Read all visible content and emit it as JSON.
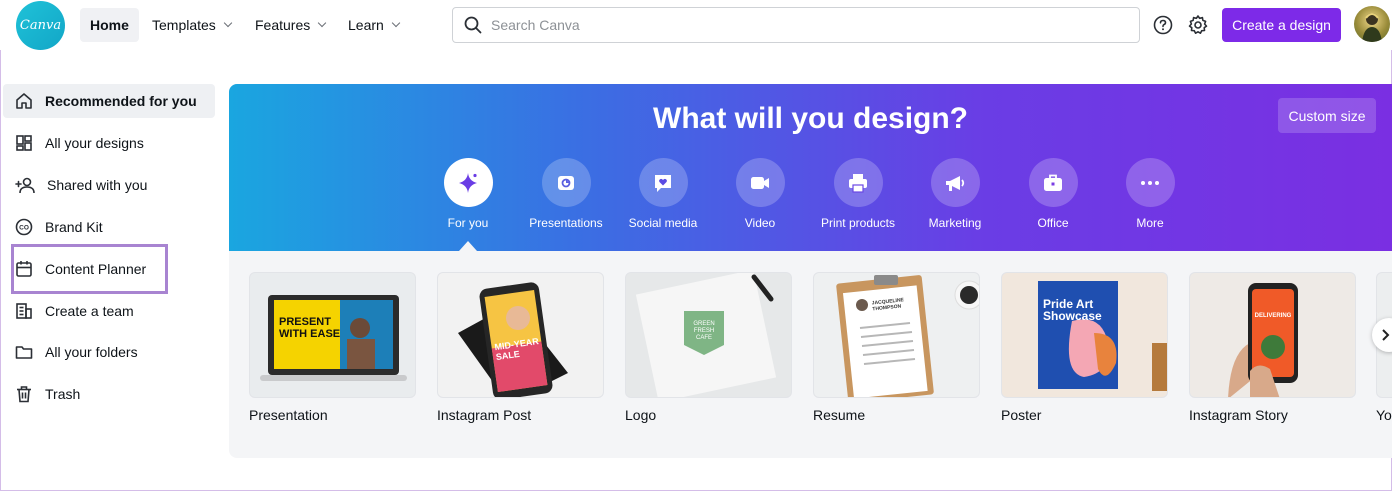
{
  "brand": {
    "logo_text": "Canva",
    "accent": "#7d2ae8"
  },
  "nav": {
    "home": "Home",
    "templates": "Templates",
    "features": "Features",
    "learn": "Learn"
  },
  "search": {
    "placeholder": "Search Canva",
    "value": ""
  },
  "header": {
    "create_label": "Create a design"
  },
  "sidebar": {
    "items": [
      {
        "label": "Recommended for you",
        "icon": "home-icon",
        "active": true
      },
      {
        "label": "All your designs",
        "icon": "grid-icon"
      },
      {
        "label": "Shared with you",
        "icon": "shared-users-icon"
      },
      {
        "label": "Brand Kit",
        "icon": "brand-kit-icon"
      },
      {
        "label": "Content Planner",
        "icon": "calendar-icon",
        "highlighted": true
      },
      {
        "label": "Create a team",
        "icon": "team-building-icon"
      },
      {
        "label": "All your folders",
        "icon": "folder-icon"
      },
      {
        "label": "Trash",
        "icon": "trash-icon"
      }
    ]
  },
  "hero": {
    "title": "What will you design?",
    "custom_size": "Custom size",
    "categories": [
      {
        "label": "For you",
        "icon": "sparkle-icon",
        "selected": true
      },
      {
        "label": "Presentations",
        "icon": "presentation-icon"
      },
      {
        "label": "Social media",
        "icon": "heart-chat-icon"
      },
      {
        "label": "Video",
        "icon": "video-camera-icon"
      },
      {
        "label": "Print products",
        "icon": "printer-icon"
      },
      {
        "label": "Marketing",
        "icon": "megaphone-icon"
      },
      {
        "label": "Office",
        "icon": "briefcase-icon"
      },
      {
        "label": "More",
        "icon": "more-dots-icon"
      }
    ]
  },
  "designs": {
    "cards": [
      {
        "label": "Presentation",
        "thumb_text": "PRESENT WITH EASE"
      },
      {
        "label": "Instagram Post",
        "thumb_text": "MID-YEAR SALE"
      },
      {
        "label": "Logo",
        "thumb_text": "GREEN FRESH CAFE"
      },
      {
        "label": "Resume",
        "thumb_text": "JACQUELINE THOMPSON"
      },
      {
        "label": "Poster",
        "thumb_text": "Pride Art Showcase"
      },
      {
        "label": "Instagram Story",
        "thumb_text": "DELIVERING"
      },
      {
        "label": "Yo"
      }
    ]
  }
}
